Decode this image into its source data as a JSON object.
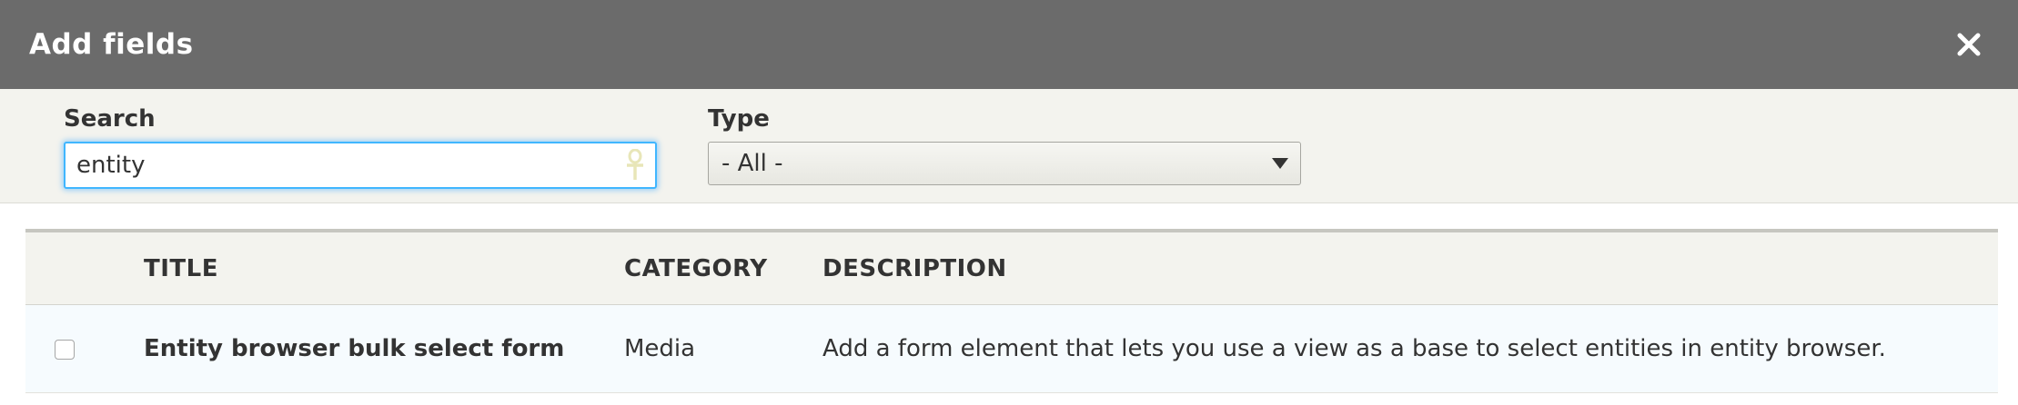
{
  "dialog": {
    "title": "Add fields",
    "close_icon": "close-icon"
  },
  "filters": {
    "search": {
      "label": "Search",
      "value": "entity",
      "badge_icon": "ankh-icon"
    },
    "type": {
      "label": "Type",
      "selected": "- All -",
      "arrow_icon": "chevron-down-icon"
    }
  },
  "table": {
    "columns": {
      "title": "TITLE",
      "category": "CATEGORY",
      "description": "DESCRIPTION"
    },
    "rows": [
      {
        "checked": false,
        "title": "Entity browser bulk select form",
        "category": "Media",
        "description": "Add a form element that lets you use a view as a base to select entities in entity browser."
      }
    ]
  },
  "colors": {
    "titlebar": "#6b6b6b",
    "filters_bg": "#f3f3ee",
    "focus_ring": "#40b6ff",
    "row_bg": "#f6fbfe"
  }
}
